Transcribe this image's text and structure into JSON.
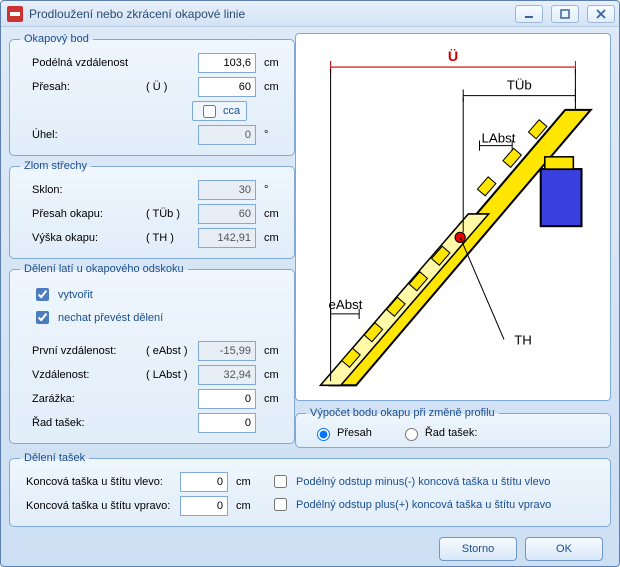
{
  "window": {
    "title": "Prodloužení nebo zkrácení okapové linie",
    "minimize_tip": "Minimize",
    "restore_tip": "Restore",
    "close_tip": "Close"
  },
  "group1": {
    "legend": "Okapový bod",
    "row_podelna": {
      "label": "Podélná vzdálenost",
      "value": "103,6",
      "unit": "cm"
    },
    "row_presah": {
      "label": "Přesah:",
      "sym": "( Ü )",
      "value": "60",
      "unit": "cm"
    },
    "cca": {
      "label": "cca",
      "checked": false
    },
    "row_uhel": {
      "label": "Úhel:",
      "value": "0",
      "unit": "°"
    }
  },
  "group2": {
    "legend": "Zlom střechy",
    "row_sklon": {
      "label": "Sklon:",
      "value": "30",
      "unit": "°"
    },
    "row_presahO": {
      "label": "Přesah okapu:",
      "sym": "( TÜb )",
      "value": "60",
      "unit": "cm"
    },
    "row_vyska": {
      "label": "Výška okapu:",
      "sym": "( TH )",
      "value": "142,91",
      "unit": "cm"
    }
  },
  "group3": {
    "legend": "Dělení latí u okapového odskoku",
    "chk_vytvorit": {
      "label": "vytvořit",
      "checked": true
    },
    "chk_prevest": {
      "label": "nechat převést dělení",
      "checked": true
    },
    "row_prvni": {
      "label": "První vzdálenost:",
      "sym": "( eAbst )",
      "value": "-15,99",
      "unit": "cm"
    },
    "row_vzd": {
      "label": "Vzdálenost:",
      "sym": "( LAbst )",
      "value": "32,94",
      "unit": "cm"
    },
    "row_zar": {
      "label": "Zarážka:",
      "value": "0",
      "unit": "cm"
    },
    "row_rad": {
      "label": "Řad tašek:",
      "value": "0"
    }
  },
  "calc": {
    "legend": "Výpočet bodu okapu při změně profilu",
    "opt_presah": "Přesah",
    "opt_rad": "Řad tašek:",
    "selected": "presah"
  },
  "group4": {
    "legend": "Dělení tašek",
    "row_kl": {
      "label": "Koncová taška u štítu vlevo:",
      "value": "0",
      "unit": "cm"
    },
    "row_kp": {
      "label": "Koncová taška u štítu vpravo:",
      "value": "0",
      "unit": "cm"
    },
    "chk_minus": {
      "label": "Podélný odstup minus(-) koncová taška u štítu vlevo",
      "checked": false
    },
    "chk_plus": {
      "label": "Podélný odstup plus(+) koncová taška u štítu vpravo",
      "checked": false
    }
  },
  "diagram": {
    "U": "Ü",
    "TUb": "TÜb",
    "LAbst": "LAbst",
    "eAbst": "eAbst",
    "TH": "TH"
  },
  "buttons": {
    "cancel": "Storno",
    "ok": "OK"
  }
}
